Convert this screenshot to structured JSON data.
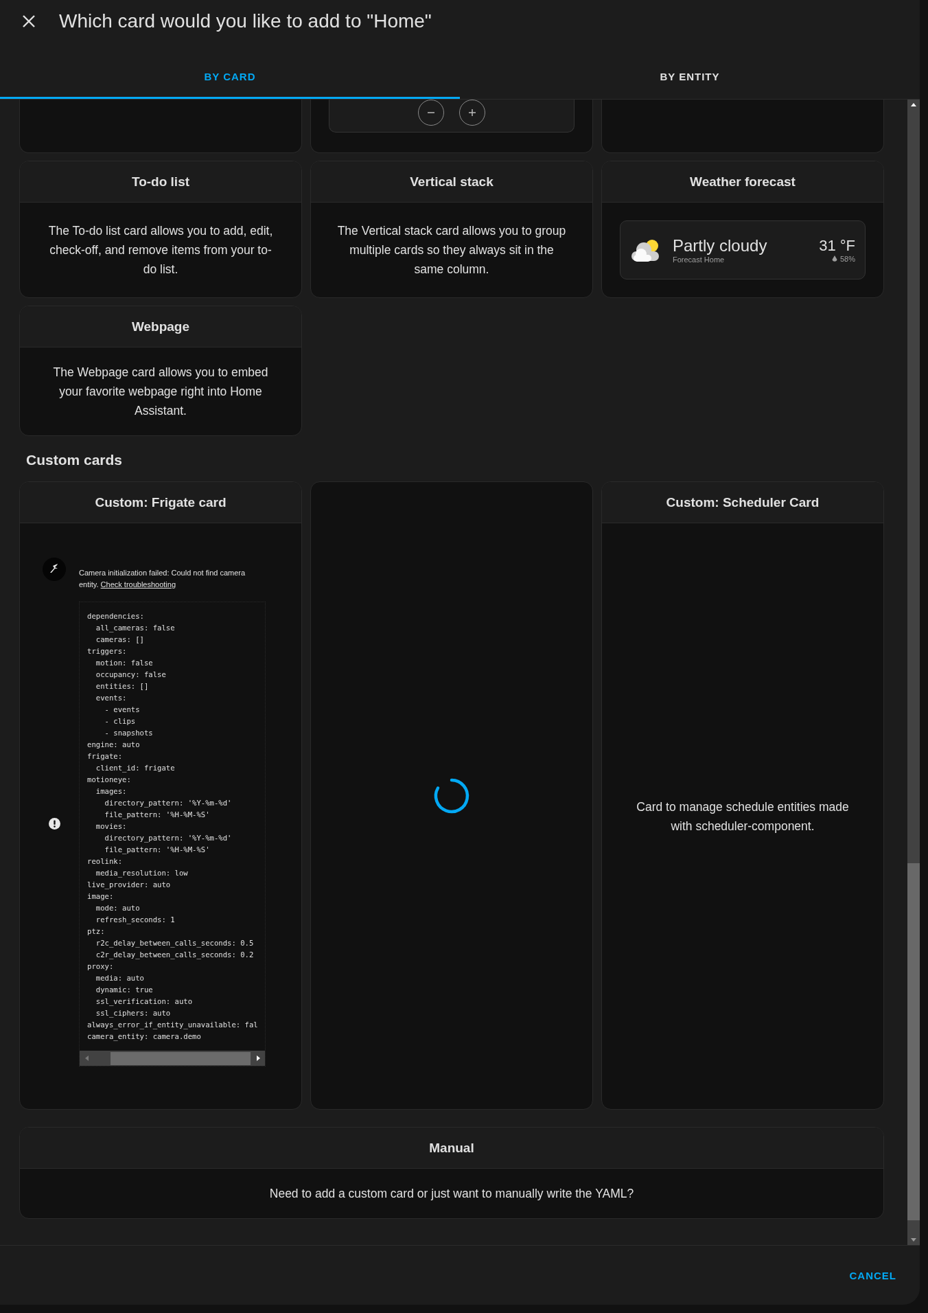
{
  "dialog": {
    "title": "Which card would you like to add to \"Home\""
  },
  "tabs": [
    {
      "label": "BY CARD",
      "selected": true
    },
    {
      "label": "BY ENTITY",
      "selected": false
    }
  ],
  "top_cards": [
    {
      "kind": "blank"
    },
    {
      "kind": "stepper"
    },
    {
      "kind": "blank"
    }
  ],
  "cards": [
    {
      "kind": "description",
      "title": "To-do list",
      "description": "The To-do list card allows you to add, edit, check-off, and remove items from your to-do list."
    },
    {
      "kind": "description",
      "title": "Vertical stack",
      "description": "The Vertical stack card allows you to group multiple cards so they always sit in the same column."
    },
    {
      "kind": "weather",
      "title": "Weather forecast",
      "preview": {
        "condition": "Partly cloudy",
        "location": "Forecast Home",
        "temperature": "31 °F",
        "humidity": "58%"
      }
    },
    {
      "kind": "description",
      "title": "Webpage",
      "description": "The Webpage card allows you to embed your favorite webpage right into Home Assistant."
    }
  ],
  "custom_section": {
    "heading": "Custom cards",
    "cards": [
      {
        "kind": "frigate",
        "title": "Custom: Frigate card",
        "message": "Camera initialization failed: Could not find camera entity.",
        "link": "Check troubleshooting",
        "code": "dependencies:\n  all_cameras: false\n  cameras: []\ntriggers:\n  motion: false\n  occupancy: false\n  entities: []\n  events:\n    - events\n    - clips\n    - snapshots\nengine: auto\nfrigate:\n  client_id: frigate\nmotioneye:\n  images:\n    directory_pattern: '%Y-%m-%d'\n    file_pattern: '%H-%M-%S'\n  movies:\n    directory_pattern: '%Y-%m-%d'\n    file_pattern: '%H-%M-%S'\nreolink:\n  media_resolution: low\nlive_provider: auto\nimage:\n  mode: auto\n  refresh_seconds: 1\nptz:\n  r2c_delay_between_calls_seconds: 0.5\n  c2r_delay_between_calls_seconds: 0.2\nproxy:\n  media: auto\n  dynamic: true\n  ssl_verification: auto\n  ssl_ciphers: auto\nalways_error_if_entity_unavailable: fal\ncamera_entity: camera.demo"
      },
      {
        "kind": "loading"
      },
      {
        "kind": "description",
        "title": "Custom: Scheduler Card",
        "description": "Card to manage schedule entities made with scheduler-component."
      }
    ]
  },
  "manual": {
    "title": "Manual",
    "description": "Need to add a custom card or just want to manually write the YAML?"
  },
  "footer": {
    "cancel": "CANCEL"
  }
}
